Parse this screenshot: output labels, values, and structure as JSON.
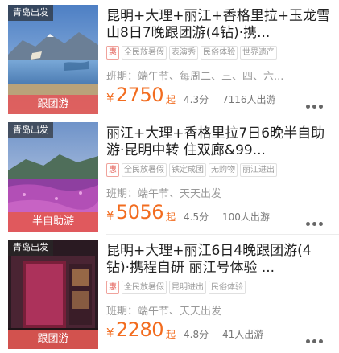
{
  "colors": {
    "accent_price": "#f26c1f",
    "badge": "#e25854",
    "hui": "#e25a52"
  },
  "items": [
    {
      "city": "青岛出发",
      "type": "跟团游",
      "title": "昆明+大理+丽江+香格里拉+玉龙雪山8日7晚跟团游(4钻)·携...",
      "tags": [
        "惠",
        "全民放暑假",
        "表演秀",
        "民俗体验",
        "世界遗产"
      ],
      "schedule": "班期：端午节、每周二、三、四、六...",
      "yen": "¥",
      "price": "2750",
      "qi": "起",
      "score": "4.3分",
      "sold": "7116人出游"
    },
    {
      "city": "青岛出发",
      "type": "半自助游",
      "title": "丽江+大理+香格里拉7日6晚半自助游·昆明中转 住双廊&99...",
      "tags": [
        "惠",
        "全民放暑假",
        "铁定成团",
        "无购物",
        "丽江进出"
      ],
      "schedule": "班期：端午节、天天出发",
      "yen": "¥",
      "price": "5056",
      "qi": "起",
      "score": "4.5分",
      "sold": "100人出游"
    },
    {
      "city": "青岛出发",
      "type": "跟团游",
      "title": "昆明+大理+丽江6日4晚跟团游(4钻)·携程自研 丽江号体验 ...",
      "tags": [
        "惠",
        "全民放暑假",
        "昆明进出",
        "民俗体验"
      ],
      "schedule": "班期：端午节、天天出发",
      "yen": "¥",
      "price": "2280",
      "qi": "起",
      "score": "4.8分",
      "sold": "41人出游"
    }
  ]
}
